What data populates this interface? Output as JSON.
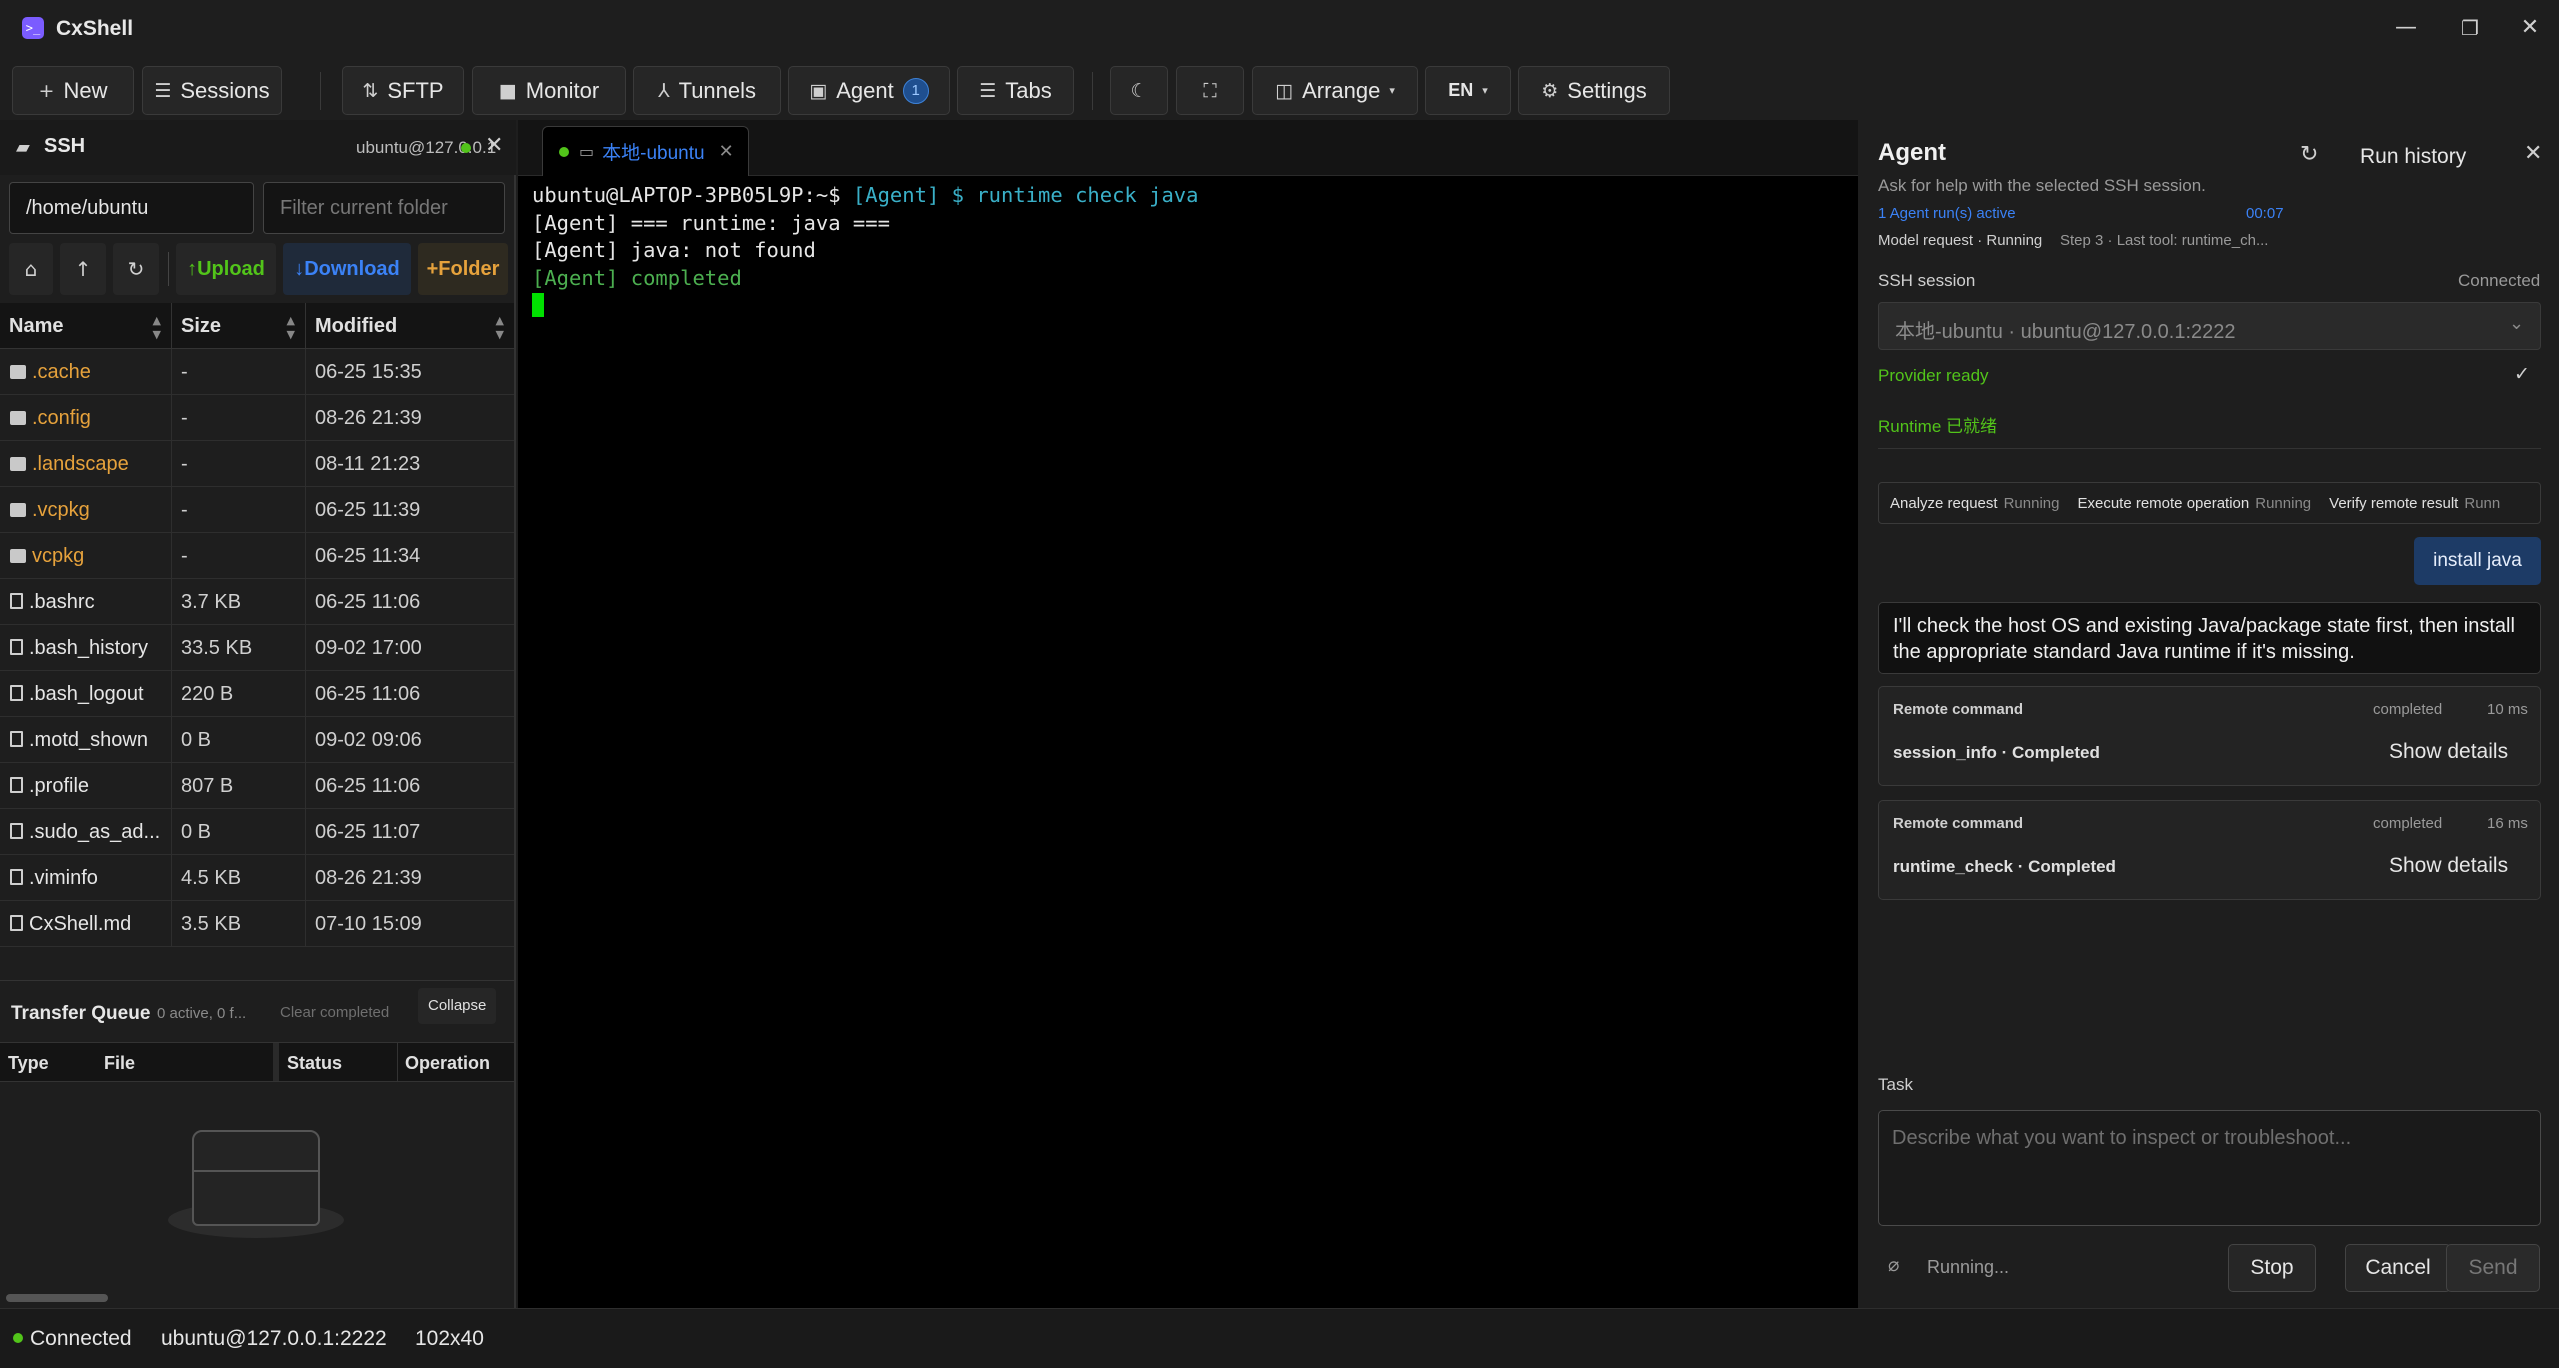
{
  "app": {
    "title": "CxShell",
    "icon": "terminal-app-icon"
  },
  "window_controls": {
    "minimize": "—",
    "restore": "❐",
    "close": "✕"
  },
  "toolbar": {
    "new": "New",
    "sessions": "Sessions",
    "sftp": "SFTP",
    "monitor": "Monitor",
    "tunnels": "Tunnels",
    "agent": "Agent",
    "agent_badge": "1",
    "tabs": "Tabs",
    "arrange": "Arrange",
    "lang": "EN",
    "settings": "Settings"
  },
  "ssh_panel": {
    "title": "SSH",
    "host": "ubuntu@127.0.0.1",
    "status_color": "#52c41a",
    "path": "/home/ubuntu",
    "filter_placeholder": "Filter current folder",
    "upload": "Upload",
    "download": "Download",
    "folder": "Folder",
    "columns": [
      "Name",
      "Size",
      "Modified"
    ],
    "files": [
      {
        "name": ".cache",
        "size": "-",
        "modified": "06-25 15:35",
        "type": "dir"
      },
      {
        "name": ".config",
        "size": "-",
        "modified": "08-26 21:39",
        "type": "dir"
      },
      {
        "name": ".landscape",
        "size": "-",
        "modified": "08-11 21:23",
        "type": "dir"
      },
      {
        "name": ".vcpkg",
        "size": "-",
        "modified": "06-25 11:39",
        "type": "dir"
      },
      {
        "name": "vcpkg",
        "size": "-",
        "modified": "06-25 11:34",
        "type": "dir"
      },
      {
        "name": ".bashrc",
        "size": "3.7 KB",
        "modified": "06-25 11:06",
        "type": "file"
      },
      {
        "name": ".bash_history",
        "size": "33.5 KB",
        "modified": "09-02 17:00",
        "type": "file"
      },
      {
        "name": ".bash_logout",
        "size": "220 B",
        "modified": "06-25 11:06",
        "type": "file"
      },
      {
        "name": ".motd_shown",
        "size": "0 B",
        "modified": "09-02 09:06",
        "type": "file"
      },
      {
        "name": ".profile",
        "size": "807 B",
        "modified": "06-25 11:06",
        "type": "file"
      },
      {
        "name": ".sudo_as_ad...",
        "size": "0 B",
        "modified": "06-25 11:07",
        "type": "file"
      },
      {
        "name": ".viminfo",
        "size": "4.5 KB",
        "modified": "08-26 21:39",
        "type": "file"
      },
      {
        "name": "CxShell.md",
        "size": "3.5 KB",
        "modified": "07-10 15:09",
        "type": "file"
      }
    ]
  },
  "transfer_queue": {
    "title": "Transfer Queue",
    "summary": "0 active, 0 f...",
    "clear": "Clear completed",
    "collapse": "Collapse",
    "columns": [
      "Type",
      "File",
      "Status",
      "Operation"
    ]
  },
  "terminal": {
    "tab_label": "本地-ubuntu",
    "prompt": "ubuntu@LAPTOP-3PB05L9P:~$",
    "command": "[Agent] $ runtime check java",
    "lines": [
      "[Agent] === runtime: java ===",
      "[Agent] java: not found"
    ],
    "completed": "[Agent] completed"
  },
  "agent": {
    "title": "Agent",
    "subtitle": "Ask for help with the selected SSH session.",
    "run_history": "Run history",
    "active_runs": "1 Agent run(s) active",
    "timer": "00:07",
    "model_status": "Model request · Running",
    "step_info": "Step 3 · Last tool: runtime_ch...",
    "ssh_session_label": "SSH session",
    "connected": "Connected",
    "session_value": "本地-ubuntu · ubuntu@127.0.0.1:2222",
    "provider_ready": "Provider ready",
    "runtime_ready": "Runtime 已就绪",
    "steps": [
      {
        "name": "Analyze request",
        "status": "Running"
      },
      {
        "name": "Execute remote operation",
        "status": "Running"
      },
      {
        "name": "Verify remote result",
        "status": "Runn"
      }
    ],
    "user_message": "install java",
    "assistant_message": "I'll check the host OS and existing Java/package state first, then install the appropriate standard Java runtime if it's missing.",
    "commands": [
      {
        "label": "Remote command",
        "status": "completed",
        "duration": "10 ms",
        "name": "session_info · Completed",
        "details": "Show details"
      },
      {
        "label": "Remote command",
        "status": "completed",
        "duration": "16 ms",
        "name": "runtime_check · Completed",
        "details": "Show details"
      }
    ],
    "task_label": "Task",
    "task_placeholder": "Describe what you want to inspect or troubleshoot...",
    "running": "Running...",
    "stop": "Stop",
    "cancel": "Cancel",
    "send": "Send"
  },
  "status_bar": {
    "state": "Connected",
    "host": "ubuntu@127.0.0.1:2222",
    "size": "102x40"
  },
  "colors": {
    "accent": "#3b82f6",
    "success": "#52c41a",
    "folder": "#e6a23c",
    "upload": "#52c41a",
    "download": "#3b82f6"
  }
}
